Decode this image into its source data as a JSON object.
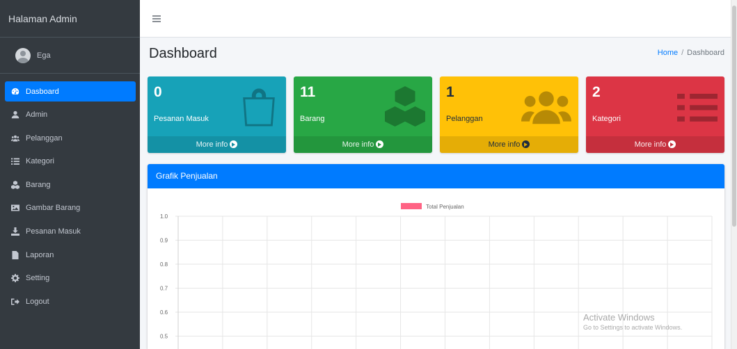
{
  "sidebar": {
    "brand": "Halaman Admin",
    "user": "Ega",
    "items": [
      {
        "label": "Dasboard",
        "icon": "tachometer-icon"
      },
      {
        "label": "Admin",
        "icon": "user-icon"
      },
      {
        "label": "Pelanggan",
        "icon": "users-icon"
      },
      {
        "label": "Kategori",
        "icon": "list-icon"
      },
      {
        "label": "Barang",
        "icon": "cubes-icon"
      },
      {
        "label": "Gambar Barang",
        "icon": "image-icon"
      },
      {
        "label": "Pesanan Masuk",
        "icon": "download-icon"
      },
      {
        "label": "Laporan",
        "icon": "file-icon"
      },
      {
        "label": "Setting",
        "icon": "cog-icon"
      },
      {
        "label": "Logout",
        "icon": "sign-out-icon"
      }
    ]
  },
  "header": {
    "title": "Dashboard",
    "breadcrumb": [
      "Home",
      "Dashboard"
    ],
    "breadcrumb_separator": "/"
  },
  "stats": [
    {
      "value": "0",
      "label": "Pesanan Masuk",
      "footer": "More info",
      "color": "#17a2b8",
      "icon": "shopping-bag-icon"
    },
    {
      "value": "11",
      "label": "Barang",
      "footer": "More info",
      "color": "#28a745",
      "icon": "cubes-icon"
    },
    {
      "value": "1",
      "label": "Pelanggan",
      "footer": "More info",
      "color": "#ffc107",
      "icon": "users-icon"
    },
    {
      "value": "2",
      "label": "Kategori",
      "footer": "More info",
      "color": "#dc3545",
      "icon": "list-icon"
    }
  ],
  "chart_card": {
    "title": "Grafik Penjualan"
  },
  "chart_data": {
    "type": "line",
    "title": "",
    "xlabel": "",
    "ylabel": "",
    "legend_position": "top",
    "series": [
      {
        "name": "Total Penjualan",
        "color": "#ff6384",
        "values": []
      }
    ],
    "ylim_visible": [
      0.5,
      1.0
    ],
    "y_ticks": [
      "1.0",
      "0.9",
      "0.8",
      "0.7",
      "0.6",
      "0.5"
    ],
    "x_gridlines": 12,
    "grid": true
  },
  "watermark": {
    "title": "Activate Windows",
    "subtitle": "Go to Settings to activate Windows."
  }
}
